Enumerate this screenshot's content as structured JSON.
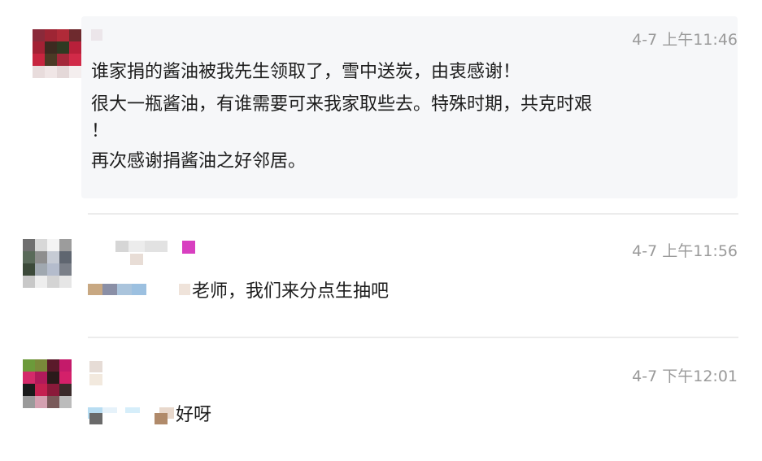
{
  "comments": [
    {
      "time": "4-7 上午11:46",
      "lines": [
        "谁家捐的酱油被我先生领取了，雪中送炭，由衷感谢！",
        "很大一瓶酱油，有谁需要可来我家取些去。特殊时期，共克时艰",
        "！",
        "再次感谢捐酱油之好邻居。"
      ]
    },
    {
      "time": "4-7 上午11:56",
      "text": "老师，我们来分点生抽吧"
    },
    {
      "time": "4-7 下午12:01",
      "text": "好呀"
    }
  ],
  "colors": {
    "time": "#9a9a9a",
    "divider": "#ececec",
    "bubble": "#f6f7f9",
    "tag": "#d83fc0"
  }
}
